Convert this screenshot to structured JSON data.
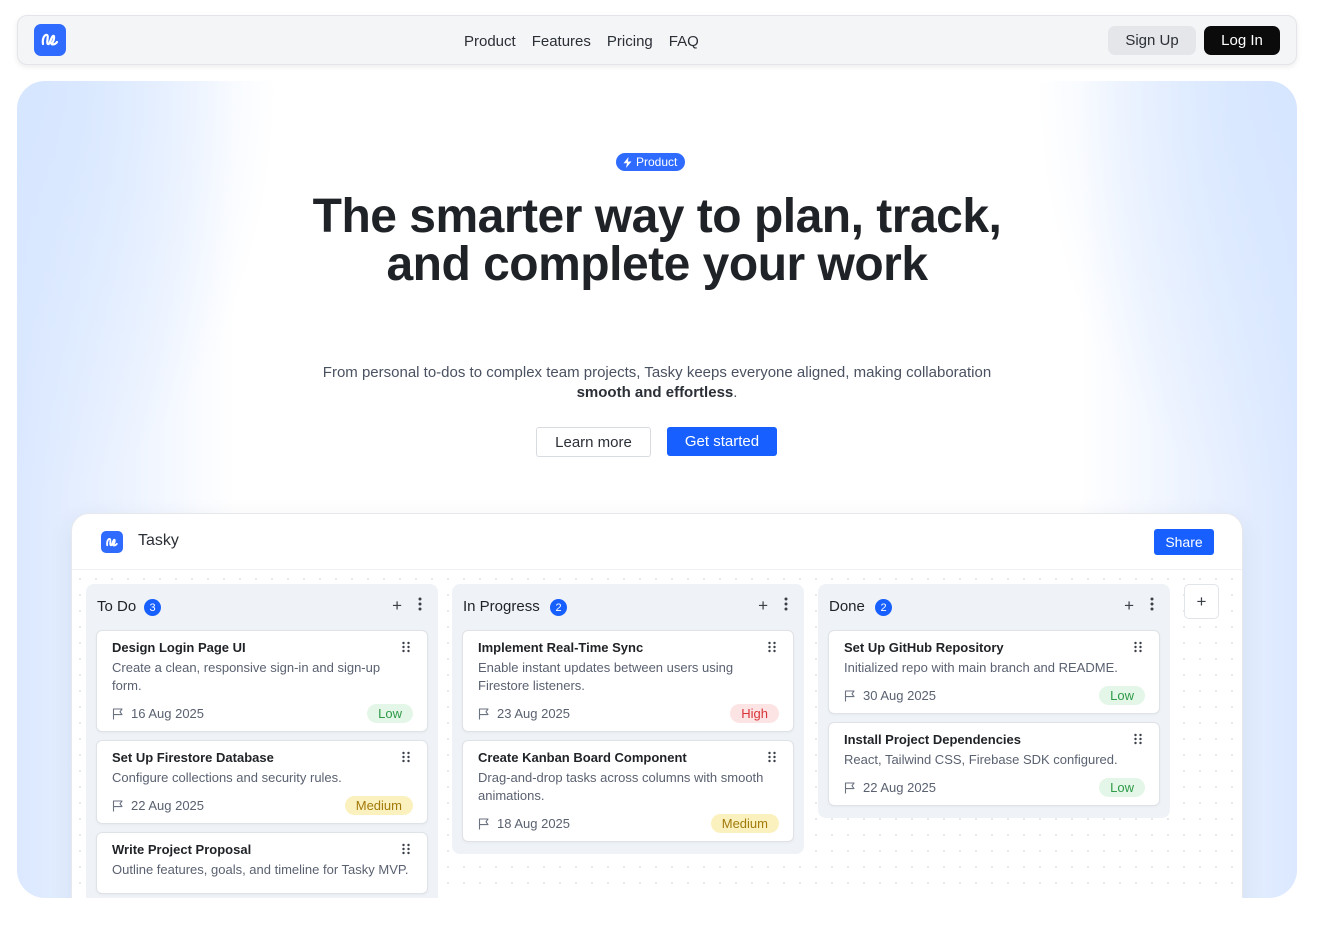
{
  "nav": {
    "logo": "tasky-logo-icon",
    "links": [
      "Product",
      "Features",
      "Pricing",
      "FAQ"
    ],
    "signup_label": "Sign Up",
    "login_label": "Log In"
  },
  "hero": {
    "badge_label": "Product",
    "headline": "The smarter way to plan, track, and complete your work",
    "subtitle_text": "From personal to-dos to complex team projects, Tasky keeps everyone aligned, making collaboration ",
    "subtitle_bold": "smooth and effortless",
    "subtitle_end": ".",
    "learn_more_label": "Learn more",
    "get_started_label": "Get started"
  },
  "app": {
    "title": "Tasky",
    "share_label": "Share",
    "columns": [
      {
        "title": "To Do",
        "count": "3",
        "cards": [
          {
            "title": "Design Login Page UI",
            "desc": "Create a clean, responsive sign-in and sign-up form.",
            "date": "16 Aug 2025",
            "priority": "Low"
          },
          {
            "title": "Set Up Firestore Database",
            "desc": "Configure collections and security rules.",
            "date": "22 Aug 2025",
            "priority": "Medium"
          },
          {
            "title": "Write Project Proposal",
            "desc": "Outline features, goals, and timeline for Tasky MVP.",
            "date": "",
            "priority": ""
          }
        ]
      },
      {
        "title": "In Progress",
        "count": "2",
        "cards": [
          {
            "title": "Implement Real-Time Sync",
            "desc": "Enable instant updates between users using Firestore listeners.",
            "date": "23 Aug 2025",
            "priority": "High"
          },
          {
            "title": "Create Kanban Board Component",
            "desc": "Drag-and-drop tasks across columns with smooth animations.",
            "date": "18 Aug 2025",
            "priority": "Medium"
          }
        ]
      },
      {
        "title": "Done",
        "count": "2",
        "cards": [
          {
            "title": "Set Up GitHub Repository",
            "desc": "Initialized repo with main branch and README.",
            "date": "30 Aug 2025",
            "priority": "Low"
          },
          {
            "title": "Install Project Dependencies",
            "desc": "React, Tailwind CSS, Firebase SDK configured.",
            "date": "22 Aug 2025",
            "priority": "Low"
          }
        ]
      }
    ]
  },
  "colors": {
    "accent": "#1760ff",
    "logo": "#2f6bff",
    "low": "#2f9a48",
    "medium": "#a27a0a",
    "high": "#d8343a"
  }
}
